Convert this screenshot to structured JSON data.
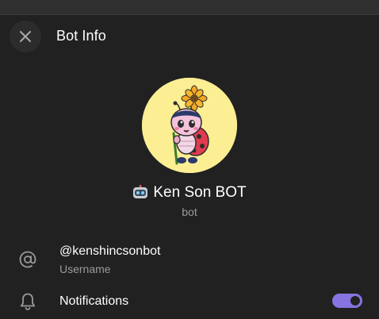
{
  "header": {
    "title": "Bot Info",
    "close_icon": "close-icon"
  },
  "profile": {
    "name": "Ken Son BOT",
    "name_emoji": "robot-face-icon",
    "subtitle": "bot",
    "avatar_background": "#fbee93"
  },
  "info": {
    "username_value": "@kenshincsonbot",
    "username_label": "Username",
    "username_icon": "at-sign-icon",
    "notifications_label": "Notifications",
    "notifications_icon": "bell-icon",
    "notifications_enabled": true
  },
  "colors": {
    "background": "#212121",
    "accent": "#8774e1",
    "secondary_text": "#9a9a9a"
  }
}
